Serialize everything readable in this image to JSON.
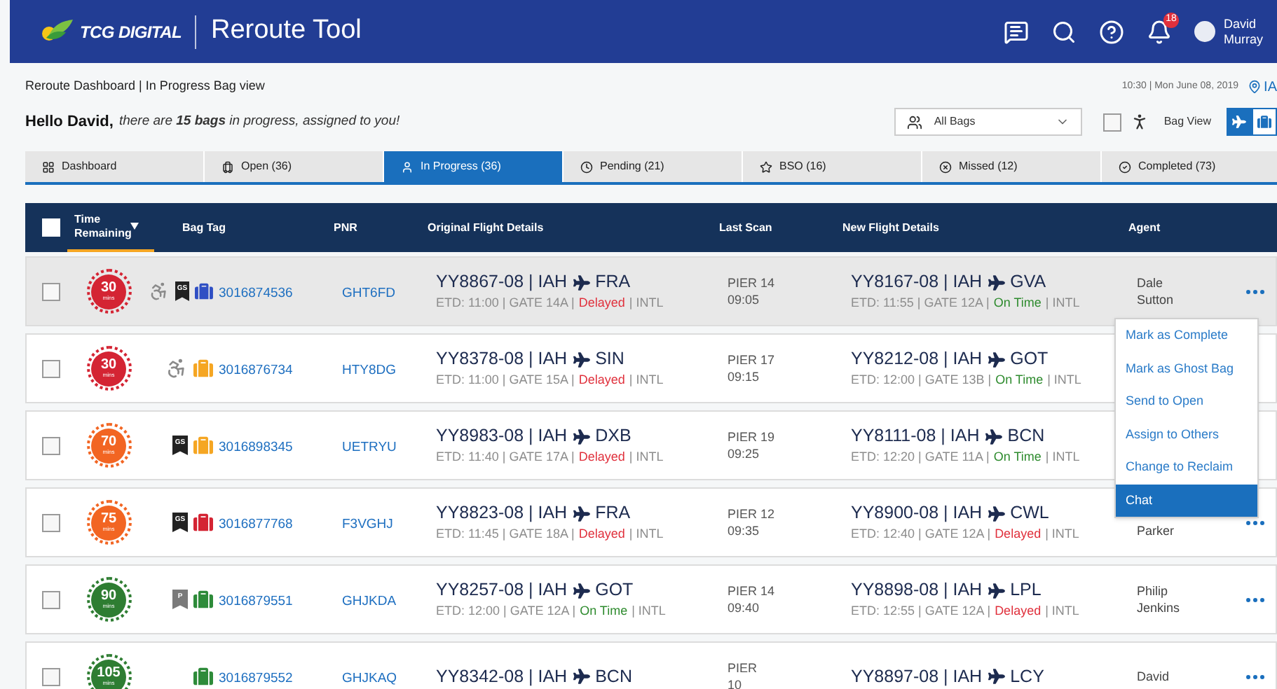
{
  "header": {
    "brand": "TCG DIGITAL",
    "title": "Reroute Tool",
    "notification_count": "18",
    "user_first": "David",
    "user_last": "Murray"
  },
  "breadcrumb": "Reroute Dashboard | In Progress Bag view",
  "datetime": "10:30 | Mon June 08, 2019",
  "location": "IA",
  "greeting_name": "Hello David,",
  "greeting_message": "there are **15 bags** in progress, assigned to you!",
  "filter": {
    "value": "All Bags"
  },
  "bag_view": {
    "checked": false,
    "label": "Bag View",
    "toggle": [
      {
        "kind": "flight",
        "selected": true
      },
      {
        "kind": "bag",
        "selected": false
      }
    ]
  },
  "tabs": [
    {
      "label": "Dashboard",
      "selected": false
    },
    {
      "label": "Open (36)",
      "selected": false
    },
    {
      "label": "In Progress (36)",
      "selected": true
    },
    {
      "label": "Pending (21)",
      "selected": false
    },
    {
      "label": "BSO (16)",
      "selected": false
    },
    {
      "label": "Missed (12)",
      "selected": false
    },
    {
      "label": "Completed (73)",
      "selected": false
    }
  ],
  "table": {
    "select_all": {
      "checked": false
    },
    "columns": [
      "Time Remaining",
      "Bag Tag",
      "PNR",
      "Original Flight Details",
      "Last Scan",
      "New Flight Details",
      "Agent"
    ],
    "rows": [
      {
        "selected": true,
        "checked": false,
        "time": "30",
        "unit": "mins",
        "color": "#d42433",
        "icons": [
          {
            "kind": "wheelchair"
          },
          {
            "kind": "tag",
            "label": "GS",
            "color": "#222222"
          },
          {
            "kind": "bag",
            "color": "#2f4fc4"
          }
        ],
        "bag_tag": "3016874536",
        "pnr": "GHT6FD",
        "original": {
          "route": "YY8867-08 | IAH",
          "to": "FRA",
          "details": "ETD: 11:00 | GATE 14A |",
          "status": "Delayed",
          "delayed": true,
          "scope": "| INTL"
        },
        "last_scan": [
          "PIER 14",
          "09:05"
        ],
        "new": {
          "route": "YY8167-08 | IAH",
          "to": "GVA",
          "details": "ETD: 11:55 | GATE 12A |",
          "status": "On Time",
          "delayed": false,
          "scope": "| INTL"
        },
        "agent": [
          "Dale",
          "Sutton"
        ],
        "agent_partly_covered": false,
        "more_button": true
      },
      {
        "selected": false,
        "checked": false,
        "time": "30",
        "unit": "mins",
        "color": "#d42433",
        "icons": [
          {
            "kind": "wheelchair"
          },
          {
            "kind": "bag",
            "color": "#f5a623"
          }
        ],
        "bag_tag": "3016876734",
        "pnr": "HTY8DG",
        "original": {
          "route": "YY8378-08 | IAH",
          "to": "SIN",
          "details": "ETD: 11:00 | GATE 15A |",
          "status": "Delayed",
          "delayed": true,
          "scope": "| INTL"
        },
        "last_scan": [
          "PIER 17",
          "09:15"
        ],
        "new": {
          "route": "YY8212-08 | IAH",
          "to": "GOT",
          "details": "ETD: 12:00 | GATE 13B |",
          "status": "On Time",
          "delayed": false,
          "scope": "| INTL"
        },
        "agent": [],
        "agent_partly_covered": false,
        "more_button": false
      },
      {
        "selected": false,
        "checked": false,
        "time": "70",
        "unit": "mins",
        "color": "#f26522",
        "icons": [
          {
            "kind": "tag",
            "label": "GS",
            "color": "#222222"
          },
          {
            "kind": "bag",
            "color": "#f5a623"
          }
        ],
        "bag_tag": "3016898345",
        "pnr": "UETRYU",
        "original": {
          "route": "YY8983-08 | IAH",
          "to": "DXB",
          "details": "ETD: 11:40 | GATE 17A |",
          "status": "Delayed",
          "delayed": true,
          "scope": "| INTL"
        },
        "last_scan": [
          "PIER 19",
          "09:25"
        ],
        "new": {
          "route": "YY8111-08 | IAH",
          "to": "BCN",
          "details": "ETD: 12:20 | GATE 11A |",
          "status": "On Time",
          "delayed": false,
          "scope": "| INTL"
        },
        "agent": [],
        "agent_partly_covered": false,
        "more_button": false
      },
      {
        "selected": false,
        "checked": false,
        "time": "75",
        "unit": "mins",
        "color": "#f26522",
        "icons": [
          {
            "kind": "tag",
            "label": "GS",
            "color": "#222222"
          },
          {
            "kind": "bag",
            "color": "#d42433"
          }
        ],
        "bag_tag": "3016877768",
        "pnr": "F3VGHJ",
        "original": {
          "route": "YY8823-08 | IAH",
          "to": "FRA",
          "details": "ETD: 11:45 | GATE 18A |",
          "status": "Delayed",
          "delayed": true,
          "scope": "| INTL"
        },
        "last_scan": [
          "PIER 12",
          "09:35"
        ],
        "new": {
          "route": "YY8900-08 | IAH",
          "to": "CWL",
          "details": "ETD: 12:40 | GATE 12A |",
          "status": "Delayed",
          "delayed": true,
          "scope": "| INTL"
        },
        "agent": [
          "Parker"
        ],
        "agent_partly_covered": true,
        "more_button": true
      },
      {
        "selected": false,
        "checked": false,
        "time": "90",
        "unit": "mins",
        "color": "#2e7d32",
        "icons": [
          {
            "kind": "tag",
            "label": "P",
            "color": "#7a7a7a"
          },
          {
            "kind": "bag",
            "color": "#2e8b3a"
          }
        ],
        "bag_tag": "3016879551",
        "pnr": "GHJKDA",
        "original": {
          "route": "YY8257-08 | IAH",
          "to": "GOT",
          "details": "ETD: 12:00 | GATE 12A |",
          "status": "On Time",
          "delayed": false,
          "scope": "| INTL"
        },
        "last_scan": [
          "PIER 14",
          "09:40"
        ],
        "new": {
          "route": "YY8898-08 | IAH",
          "to": "LPL",
          "details": "ETD: 12:55 | GATE 12A |",
          "status": "Delayed",
          "delayed": true,
          "scope": "| INTL"
        },
        "agent": [
          "Philip",
          "Jenkins"
        ],
        "agent_partly_covered": false,
        "more_button": true
      },
      {
        "selected": false,
        "checked": false,
        "time": "105",
        "unit": "mins",
        "color": "#2e7d32",
        "icons": [
          {
            "kind": "bag",
            "color": "#2e8b3a"
          }
        ],
        "bag_tag": "3016879552",
        "pnr": "GHJKAQ",
        "original": {
          "route": "YY8342-08 | IAH",
          "to": "BCN"
        },
        "last_scan": [
          "PIER",
          "10"
        ],
        "new": {
          "route": "YY8897-08 | IAH",
          "to": "LCY"
        },
        "agent": [
          "David"
        ],
        "agent_partly_covered": false,
        "more_button": true
      }
    ]
  },
  "row_menu": {
    "items": [
      {
        "label": "Mark as Complete",
        "selected": false
      },
      {
        "label": "Mark as Ghost Bag",
        "selected": false
      },
      {
        "label": "Send to Open",
        "selected": false
      },
      {
        "label": "Assign to Others",
        "selected": false
      },
      {
        "label": "Change to Reclaim",
        "selected": false
      },
      {
        "label": "Chat",
        "selected": true
      }
    ]
  }
}
